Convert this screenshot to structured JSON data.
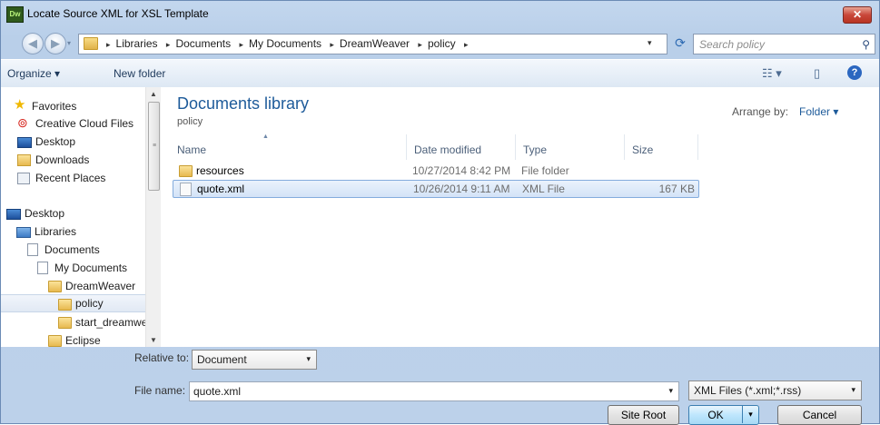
{
  "window": {
    "title": "Locate Source XML for XSL Template",
    "app_icon_text": "Dw",
    "close_glyph": "✕"
  },
  "address": {
    "back_glyph": "◀",
    "forward_glyph": "▶",
    "crumbs": [
      "Libraries",
      "Documents",
      "My Documents",
      "DreamWeaver",
      "policy"
    ],
    "separator": "▸",
    "dropdown_glyph": "▾",
    "refresh_glyph": "⟳"
  },
  "search": {
    "placeholder": "Search policy",
    "icon_glyph": "⚲"
  },
  "toolbar": {
    "organize_label": "Organize ▾",
    "new_folder_label": "New folder",
    "views_glyph": "☷ ▾",
    "pane_glyph": "▯",
    "help_glyph": "?"
  },
  "nav": {
    "items": [
      {
        "label": "Favorites"
      },
      {
        "label": "Creative Cloud Files"
      },
      {
        "label": "Desktop"
      },
      {
        "label": "Downloads"
      },
      {
        "label": "Recent Places"
      },
      {
        "label": "Desktop"
      },
      {
        "label": "Libraries"
      },
      {
        "label": "Documents"
      },
      {
        "label": "My Documents"
      },
      {
        "label": "DreamWeaver"
      },
      {
        "label": "policy"
      },
      {
        "label": "start_dreamweaver"
      },
      {
        "label": "Eclipse"
      }
    ],
    "scroll_up": "▲",
    "scroll_down": "▼",
    "grip": "≡"
  },
  "main": {
    "library_title": "Documents library",
    "library_sub": "policy",
    "arrange_label": "Arrange by:",
    "arrange_value": "Folder ▾",
    "sort_glyph": "▲",
    "columns": {
      "name": "Name",
      "date": "Date modified",
      "type": "Type",
      "size": "Size"
    },
    "files": [
      {
        "name": "resources",
        "date": "10/27/2014 8:42 PM",
        "type": "File folder",
        "size": ""
      },
      {
        "name": "quote.xml",
        "date": "10/26/2014 9:11 AM",
        "type": "XML File",
        "size": "167 KB"
      }
    ]
  },
  "bottom": {
    "relative_label": "Relative to:",
    "relative_value": "Document",
    "filename_label": "File name:",
    "filename_value": "quote.xml",
    "filter_value": "XML Files (*.xml;*.rss)",
    "arrow_glyph": "▾",
    "site_root_label": "Site Root",
    "ok_label": "OK",
    "cancel_label": "Cancel"
  },
  "colors": {
    "accent": "#1e5b9a",
    "selection": "#d3e3f7",
    "title_gradient": "#bcd1ea"
  }
}
